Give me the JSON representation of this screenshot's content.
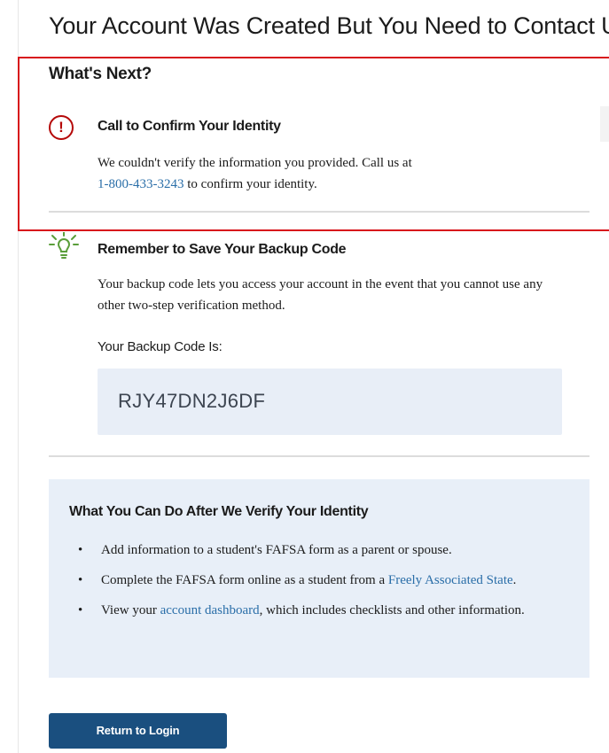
{
  "page": {
    "title": "Your Account Was Created But You Need to Contact Us"
  },
  "whats_next": {
    "heading": "What's Next?"
  },
  "confirm_identity": {
    "icon": "alert-circle-icon",
    "icon_glyph": "!",
    "title": "Call to Confirm Your Identity",
    "text_before": "We couldn't verify the information you provided. Call us at",
    "phone": "1-800-433-3243",
    "text_after": " to confirm your identity."
  },
  "backup_code": {
    "icon": "lightbulb-icon",
    "title": "Remember to Save Your Backup Code",
    "description": "Your backup code lets you access your account in the event that you cannot use any other two-step verification method.",
    "label": "Your Backup Code Is:",
    "code": "RJY47DN2J6DF"
  },
  "after_verify": {
    "title": "What You Can Do After We Verify Your Identity",
    "items": [
      {
        "text_before": "Add information to a student's FAFSA form as a parent or spouse.",
        "link": "",
        "text_after": ""
      },
      {
        "text_before": "Complete the FAFSA form online as a student from a ",
        "link": "Freely Associated State",
        "text_after": "."
      },
      {
        "text_before": "View your ",
        "link": "account dashboard",
        "text_after": ", which includes checklists and other information."
      }
    ]
  },
  "actions": {
    "return_label": "Return to Login"
  },
  "colors": {
    "highlight_border": "#d8141b",
    "alert_red": "#b50909",
    "link_blue": "#2a6ea8",
    "panel_bg": "#e8eff8",
    "button_bg": "#1a4f7f"
  }
}
